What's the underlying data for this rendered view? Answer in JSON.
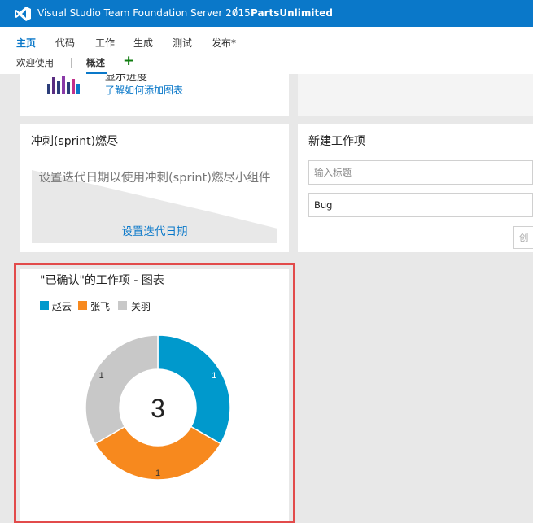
{
  "header": {
    "product": "Visual Studio Team Foundation Server 2015",
    "separator": "/",
    "project": "PartsUnlimited"
  },
  "nav": {
    "items": [
      {
        "label": "主页",
        "active": true
      },
      {
        "label": "代码",
        "active": false
      },
      {
        "label": "工作",
        "active": false
      },
      {
        "label": "生成",
        "active": false
      },
      {
        "label": "测试",
        "active": false
      },
      {
        "label": "发布*",
        "active": false
      }
    ],
    "sub_items": [
      {
        "label": "欢迎使用",
        "active": false
      },
      {
        "label": "概述",
        "active": true
      }
    ],
    "add_label": "+"
  },
  "top_tile": {
    "partial_text": "显示进度",
    "link": "了解如何添加图表"
  },
  "sprint_tile": {
    "title": "冲刺(sprint)燃尽",
    "message": "设置迭代日期以使用冲刺(sprint)燃尽小组件",
    "link": "设置迭代日期"
  },
  "new_work_item": {
    "title": "新建工作项",
    "title_placeholder": "输入标题",
    "type_value": "Bug",
    "create_label": "创"
  },
  "chart_tile": {
    "title": "\"已确认\"的工作项 - 图表",
    "total": "3"
  },
  "colors": {
    "brand": "#0a78c9",
    "zhao": "#0099cc",
    "zhang": "#f7891e",
    "guan": "#c8c8c8"
  },
  "chart_data": {
    "type": "pie",
    "categories": [
      "赵云",
      "张飞",
      "关羽"
    ],
    "values": [
      1,
      1,
      1
    ],
    "title": "\"已确认\"的工作项 - 图表",
    "legend": "top-left",
    "center_label": "3"
  }
}
